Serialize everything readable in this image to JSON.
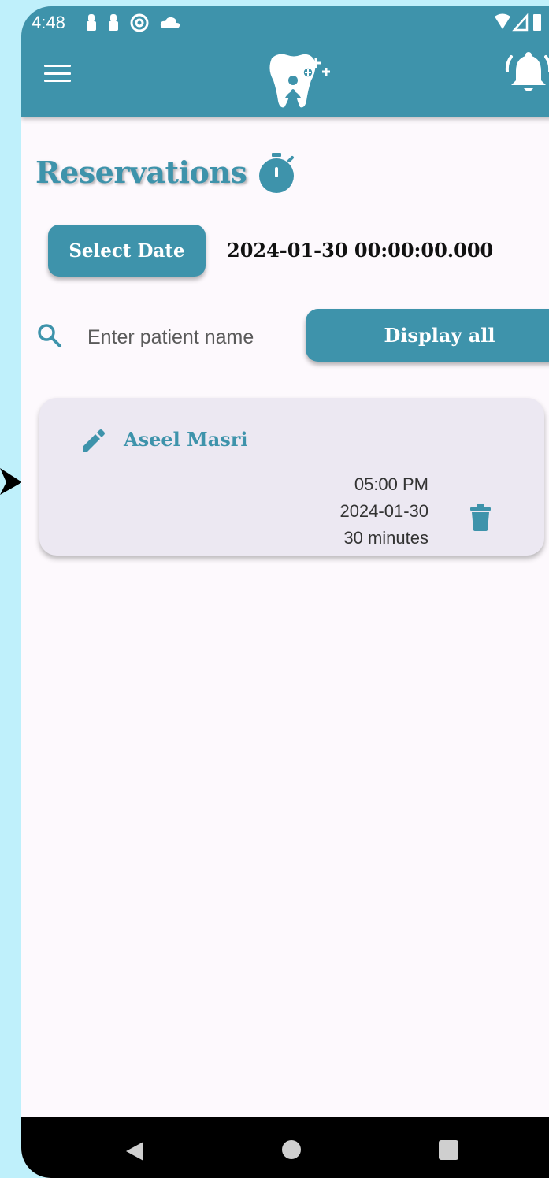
{
  "status_bar": {
    "time": "4:48"
  },
  "page": {
    "title": "Reservations"
  },
  "date_picker": {
    "button_label": "Select Date",
    "selected_value": "2024-01-30 00:00:00.000"
  },
  "search": {
    "placeholder": "Enter patient name",
    "display_all_label": "Display all"
  },
  "reservations": [
    {
      "patient_name": "Aseel Masri",
      "time": "05:00 PM",
      "date": "2024-01-30",
      "duration": "30 minutes"
    }
  ],
  "colors": {
    "primary": "#3e93ab",
    "card_bg": "#ece8f2",
    "page_bg": "#fdf9fd",
    "outer_bg": "#bff0fb"
  },
  "icons": [
    "menu-icon",
    "tooth-logo-icon",
    "bell-icon",
    "stopwatch-icon",
    "search-icon",
    "edit-icon",
    "trash-icon",
    "nav-back-icon",
    "nav-home-icon",
    "nav-recent-icon"
  ]
}
